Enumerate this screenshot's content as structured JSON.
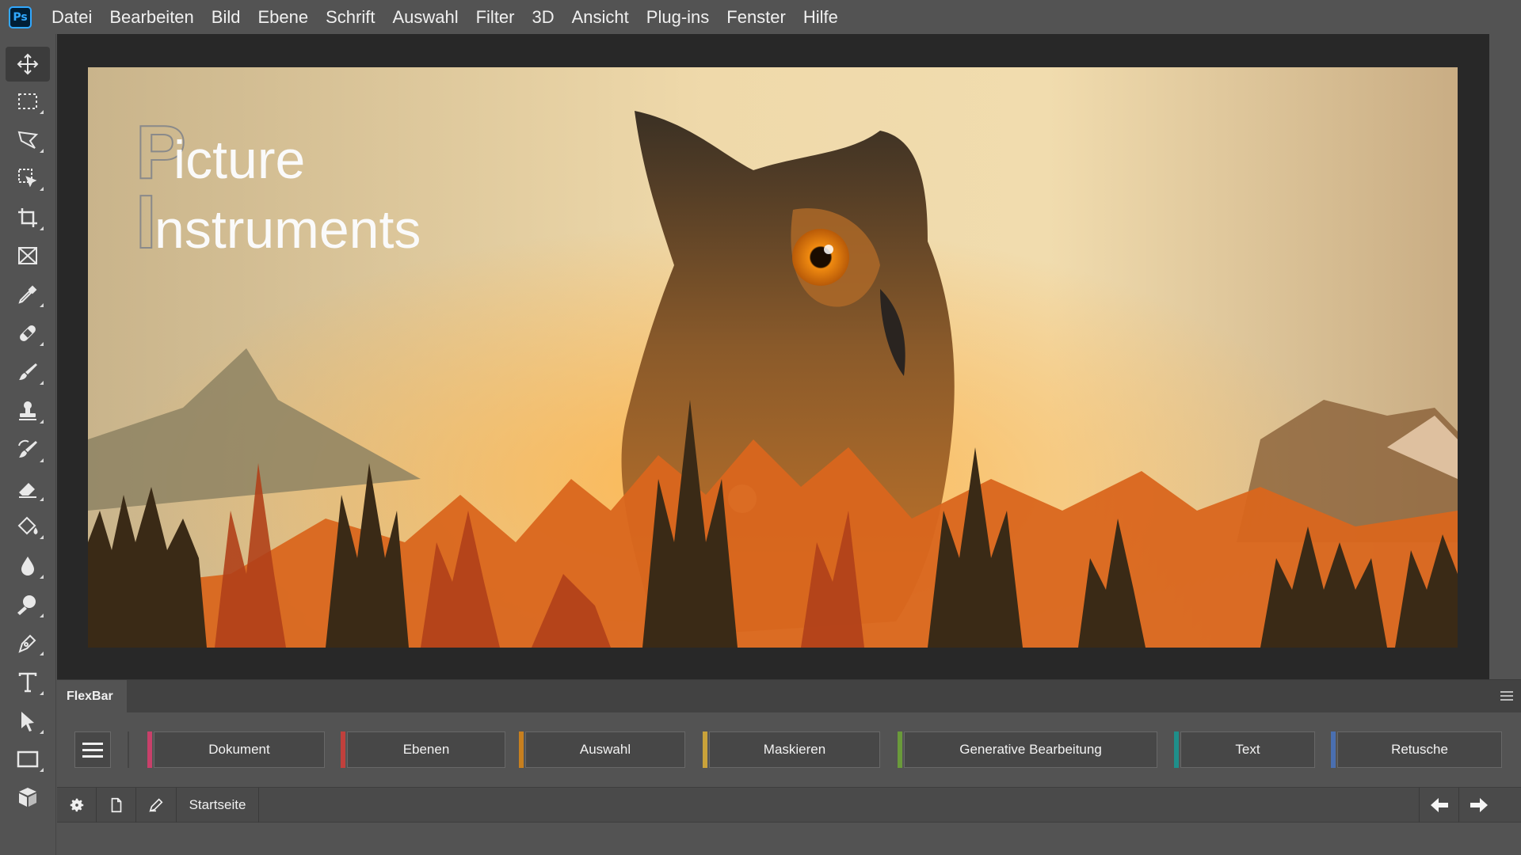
{
  "app": {
    "logo_text": "Ps"
  },
  "menu": [
    "Datei",
    "Bearbeiten",
    "Bild",
    "Ebene",
    "Schrift",
    "Auswahl",
    "Filter",
    "3D",
    "Ansicht",
    "Plug-ins",
    "Fenster",
    "Hilfe"
  ],
  "tools": [
    {
      "name": "move-tool",
      "icon": "move-icon",
      "active": true
    },
    {
      "name": "marquee-tool",
      "icon": "rect-marquee-icon"
    },
    {
      "name": "lasso-tool",
      "icon": "polygon-lasso-icon"
    },
    {
      "name": "object-selection-tool",
      "icon": "object-selection-icon"
    },
    {
      "name": "crop-tool",
      "icon": "crop-icon"
    },
    {
      "name": "frame-tool",
      "icon": "frame-icon"
    },
    {
      "name": "eyedropper-tool",
      "icon": "eyedropper-icon"
    },
    {
      "name": "healing-tool",
      "icon": "bandage-icon"
    },
    {
      "name": "brush-tool",
      "icon": "brush-icon"
    },
    {
      "name": "stamp-tool",
      "icon": "stamp-icon"
    },
    {
      "name": "history-brush-tool",
      "icon": "history-brush-icon"
    },
    {
      "name": "eraser-tool",
      "icon": "eraser-icon"
    },
    {
      "name": "paint-bucket-tool",
      "icon": "paint-bucket-icon"
    },
    {
      "name": "blur-tool",
      "icon": "drop-icon"
    },
    {
      "name": "dodge-tool",
      "icon": "dodge-icon"
    },
    {
      "name": "pen-tool",
      "icon": "pen-icon"
    },
    {
      "name": "type-tool",
      "icon": "type-icon"
    },
    {
      "name": "path-selection-tool",
      "icon": "arrow-cursor-icon"
    },
    {
      "name": "rectangle-tool",
      "icon": "rectangle-icon"
    },
    {
      "name": "3d-tool",
      "icon": "cube-icon"
    }
  ],
  "canvas": {
    "logo_line1": "Picture",
    "logo_line2": "Instruments"
  },
  "panel": {
    "tab_label": "FlexBar",
    "categories": [
      {
        "label": "Dokument",
        "color": "#c8406a"
      },
      {
        "label": "Ebenen",
        "color": "#c0403c"
      },
      {
        "label": "Auswahl",
        "color": "#c77f1e"
      },
      {
        "label": "Maskieren",
        "color": "#c9a23a"
      },
      {
        "label": "Generative Bearbeitung",
        "color": "#6a9a3a"
      },
      {
        "label": "Text",
        "color": "#1f8f8a"
      },
      {
        "label": "Retusche",
        "color": "#4a6fb0"
      }
    ],
    "footer": {
      "home_label": "Startseite"
    }
  }
}
